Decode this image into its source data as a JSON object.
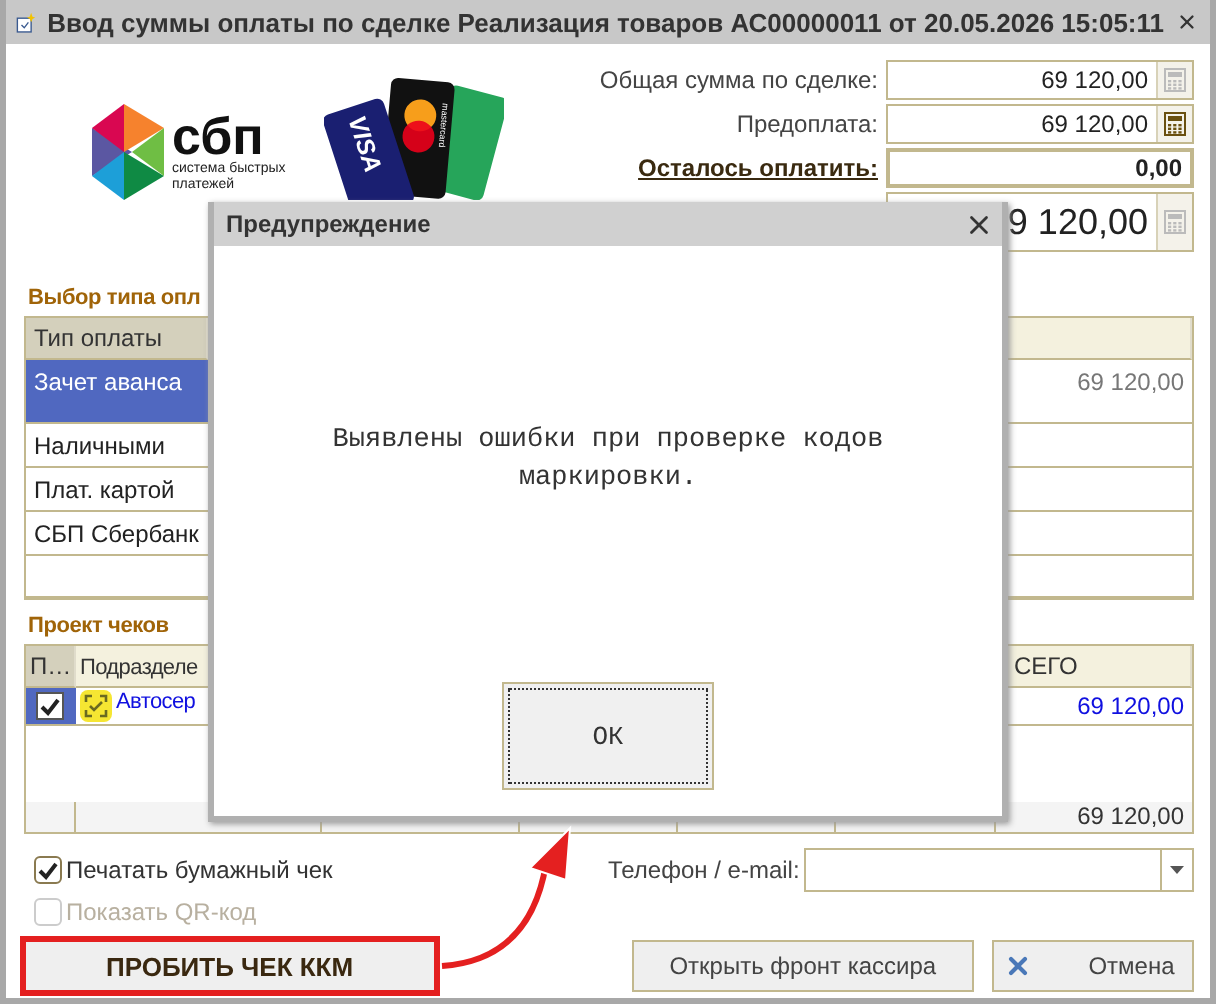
{
  "window": {
    "title": "Ввод суммы оплаты по сделке Реализация товаров АС00000011 от 20.05.2026 15:05:11"
  },
  "logos": {
    "sbp_name": "сбп",
    "sbp_caption": "система быстрых платежей",
    "card_brands": [
      "VISA",
      "mastercard"
    ]
  },
  "totals": [
    {
      "kind": "plain",
      "label": "Общая сумма по сделке:",
      "value": "69 120,00",
      "calculator_enabled": false
    },
    {
      "kind": "plain",
      "label": "Предоплата:",
      "value": "69 120,00",
      "calculator_enabled": true
    },
    {
      "kind": "bold",
      "label": "Осталось оплатить:",
      "value": "0,00"
    },
    {
      "kind": "large",
      "value": "9 120,00",
      "calculator_enabled": false
    }
  ],
  "payment_types": {
    "title": "Выбор типа опл",
    "column": "Тип оплаты",
    "rows": [
      {
        "name": "Зачет аванса",
        "amount": "69 120,00",
        "selected": true
      },
      {
        "name": "Наличными",
        "selected": false
      },
      {
        "name": "Плат. картой",
        "selected": false
      },
      {
        "name": "СБП Сбербанк",
        "selected": false
      }
    ]
  },
  "checks": {
    "title": "Проект чеков",
    "columns": [
      "П…",
      "Подразделе",
      "СЕГО"
    ],
    "rows": [
      {
        "checked": true,
        "name": "Автосер",
        "total": "69 120,00"
      }
    ],
    "footer_total": "69 120,00"
  },
  "options": [
    {
      "label": "Печатать бумажный чек",
      "checked": true,
      "disabled": false
    },
    {
      "label": "Показать QR-код",
      "checked": false,
      "disabled": true
    }
  ],
  "contact": {
    "label": "Телефон / e-mail:"
  },
  "buttons": [
    {
      "kind": "primary",
      "label": "ПРОБИТЬ ЧЕК ККМ",
      "highlighted": true
    },
    {
      "kind": "plain",
      "label": "Открыть фронт кассира"
    },
    {
      "kind": "cancel",
      "label": "Отмена"
    }
  ],
  "dialog": {
    "title": "Предупреждение",
    "message": "Выявлены ошибки при проверке кодов маркировки.",
    "button": "ОК"
  }
}
